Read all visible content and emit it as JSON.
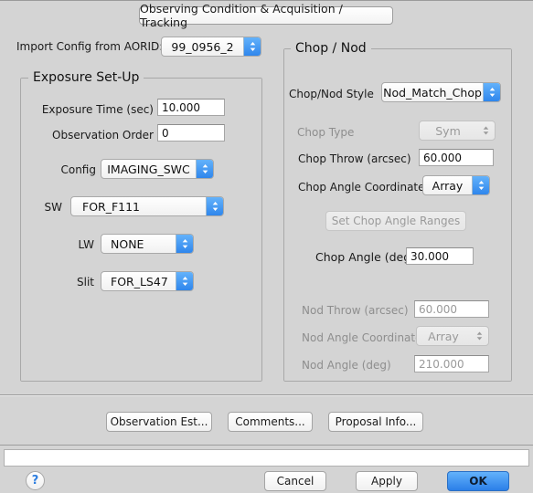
{
  "window": {
    "tab_title": "Observing Condition & Acquisition / Tracking"
  },
  "import": {
    "label": "Import Config from AORID:",
    "value": "99_0956_2"
  },
  "exposure": {
    "title": "Exposure Set-Up",
    "exposure_time_label": "Exposure Time (sec)",
    "exposure_time_value": "10.000",
    "observation_order_label": "Observation Order",
    "observation_order_value": "0",
    "config_label": "Config",
    "config_value": "IMAGING_SWC",
    "sw_label": "SW",
    "sw_value": "FOR_F111",
    "lw_label": "LW",
    "lw_value": "NONE",
    "slit_label": "Slit",
    "slit_value": "FOR_LS47"
  },
  "chopnod": {
    "title": "Chop / Nod",
    "style_label": "Chop/Nod Style",
    "style_value": "Nod_Match_Chop",
    "chop_type_label": "Chop Type",
    "chop_type_value": "Sym",
    "chop_throw_label": "Chop Throw (arcsec)",
    "chop_throw_value": "60.000",
    "chop_angle_coord_label": "Chop Angle Coordinate",
    "chop_angle_coord_value": "Array",
    "set_ranges_label": "Set Chop Angle Ranges",
    "chop_angle_label": "Chop Angle (deg)",
    "chop_angle_value": "30.000",
    "nod_throw_label": "Nod Throw (arcsec)",
    "nod_throw_value": "60.000",
    "nod_angle_coord_label": "Nod Angle Coordinate",
    "nod_angle_coord_value": "Array",
    "nod_angle_label": "Nod Angle (deg)",
    "nod_angle_value": "210.000"
  },
  "actions": {
    "observation_est": "Observation Est...",
    "comments": "Comments...",
    "proposal_info": "Proposal Info..."
  },
  "statusbar": {
    "text": ""
  },
  "footer": {
    "help": "?",
    "cancel": "Cancel",
    "apply": "Apply",
    "ok": "OK"
  },
  "colors": {
    "accent_blue": "#2f86ec",
    "window_bg": "#d4d4d4",
    "disabled_text": "#9a9a9a"
  }
}
